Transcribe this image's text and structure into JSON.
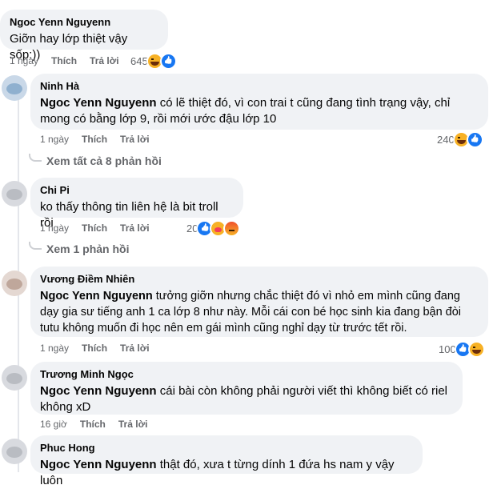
{
  "comments": [
    {
      "author": "Ngoc Yenn Nguyenn",
      "mention": "",
      "text": "Giỡn hay lớp thiệt vậy sốp:))",
      "time": "1 ngày",
      "like": "Thích",
      "reply": "Trả lời",
      "count": "645",
      "reacts": [
        "haha",
        "like"
      ]
    },
    {
      "author": "Ninh Hà",
      "mention": "Ngoc Yenn Nguyenn",
      "text": " có lẽ thiệt đó, vì con trai t cũng đang tình trạng vậy, chỉ mong có bằng lớp 9, rồi mới ước đậu lớp 10",
      "time": "1 ngày",
      "like": "Thích",
      "reply": "Trả lời",
      "count": "240",
      "reacts": [
        "haha",
        "like"
      ]
    },
    {
      "author": "Chi Pi",
      "mention": "",
      "text": "ko thấy thông tin liên hệ là bit troll rồi",
      "time": "1 ngày",
      "like": "Thích",
      "reply": "Trả lời",
      "count": "20",
      "reacts": [
        "like",
        "care",
        "angry"
      ]
    },
    {
      "author": "Vương Điềm Nhiên",
      "mention": "Ngoc Yenn Nguyenn",
      "text": " tưởng giỡn nhưng chắc thiệt đó vì nhỏ em mình cũng đang dạy gia sư tiếng anh 1 ca lớp 8 như này. Mỗi cái con bé học sinh kia đang bận đòi tutu không muốn đi học nên em gái mình cũng nghỉ dạy từ trước tết rồi.",
      "time": "1 ngày",
      "like": "Thích",
      "reply": "Trả lời",
      "count": "100",
      "reacts": [
        "like",
        "haha"
      ]
    },
    {
      "author": "Trương Minh Ngọc",
      "mention": "Ngoc Yenn Nguyenn",
      "text": " cái bài còn không phải người viết thì không biết có riel không xD",
      "time": "16 giờ",
      "like": "Thích",
      "reply": "Trả lời",
      "count": "",
      "reacts": []
    },
    {
      "author": "Phuc Hong",
      "mention": "Ngoc Yenn Nguyenn",
      "text": " thật đó, xưa t từng dính 1 đứa hs nam y vậy luôn",
      "time": "",
      "like": "",
      "reply": "",
      "count": "",
      "reacts": []
    }
  ],
  "view_replies_1": "Xem tất cả 8 phản hồi",
  "view_replies_2": "Xem 1 phản hồi"
}
